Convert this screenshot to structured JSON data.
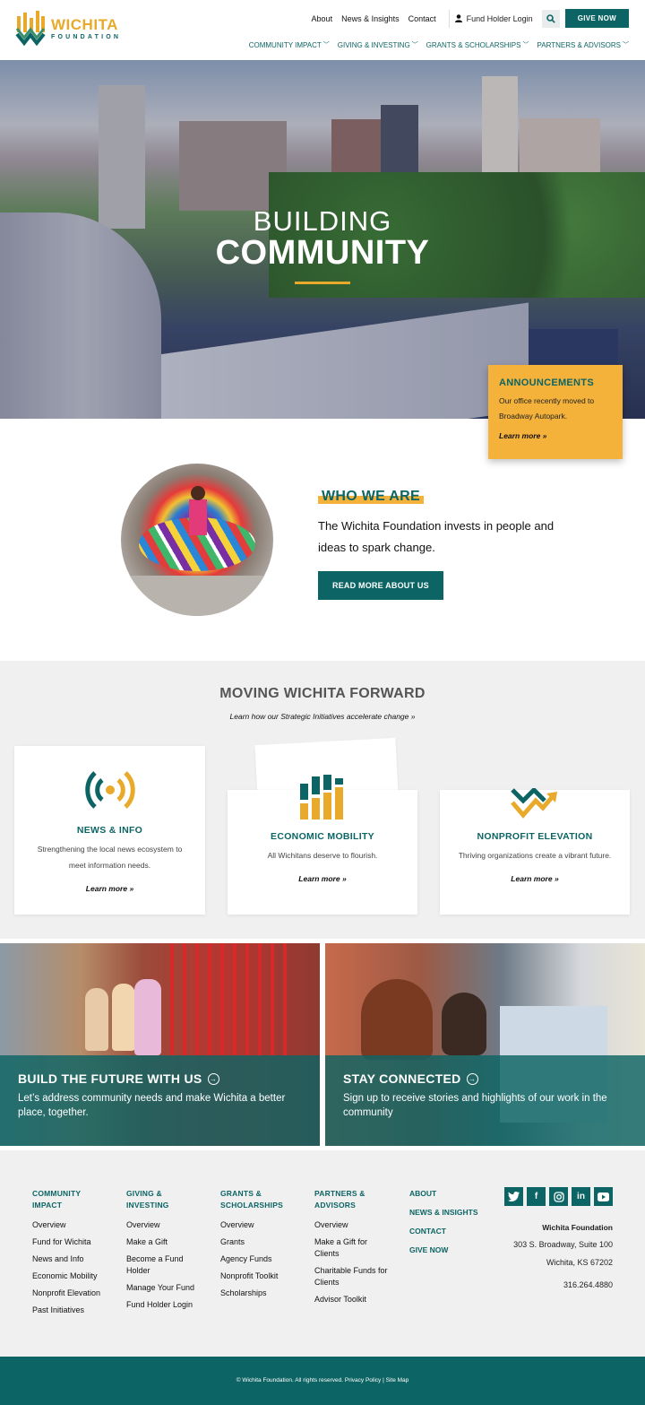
{
  "logo": {
    "line1": "WICHITA",
    "line2": "FOUNDATION"
  },
  "top_links": {
    "about": "About",
    "news": "News & Insights",
    "contact": "Contact",
    "fund_holder": "Fund Holder Login",
    "give": "GIVE NOW"
  },
  "nav": [
    "COMMUNITY IMPACT",
    "GIVING & INVESTING",
    "GRANTS & SCHOLARSHIPS",
    "PARTNERS & ADVISORS"
  ],
  "hero": {
    "line1": "BUILDING",
    "line2": "COMMUNITY"
  },
  "announcement": {
    "title": "ANNOUNCEMENTS",
    "body": "Our office recently moved to Broadway Autopark.",
    "link": "Learn more »"
  },
  "who": {
    "heading": "WHO WE ARE",
    "body": "The Wichita Foundation invests in people and ideas to spark change.",
    "button": "READ MORE ABOUT US"
  },
  "moving": {
    "title": "MOVING WICHITA FORWARD",
    "subtitle": "Learn how our Strategic Initiatives accelerate change »",
    "cards": [
      {
        "title": "NEWS & INFO",
        "body": "Strengthening the local news ecosystem to meet information needs.",
        "link": "Learn more »"
      },
      {
        "title": "ECONOMIC MOBILITY",
        "body": "All Wichitans deserve to flourish.",
        "link": "Learn more »"
      },
      {
        "title": "NONPROFIT ELEVATION",
        "body": "Thriving organizations create a vibrant future.",
        "link": "Learn more »"
      }
    ]
  },
  "promos": [
    {
      "title": "BUILD THE FUTURE WITH US",
      "body": "Let’s address community needs and make Wichita a better place, together."
    },
    {
      "title": "STAY CONNECTED",
      "body": "Sign up to receive stories and highlights of our work in the community"
    }
  ],
  "footer": {
    "col1": {
      "heading": "COMMUNITY IMPACT",
      "links": [
        "Overview",
        "Fund for Wichita",
        "News and Info",
        "Economic Mobility",
        "Nonprofit Elevation",
        "Past Initiatives"
      ]
    },
    "col2": {
      "heading": "GIVING & INVESTING",
      "links": [
        "Overview",
        "Make a Gift",
        "Become a Fund Holder",
        "Manage Your Fund",
        "Fund Holder Login"
      ]
    },
    "col3": {
      "heading": "GRANTS & SCHOLARSHIPS",
      "links": [
        "Overview",
        "Grants",
        "Agency Funds",
        "Nonprofit Toolkit",
        "Scholarships"
      ]
    },
    "col4": {
      "heading": "PARTNERS & ADVISORS",
      "links": [
        "Overview",
        "Make a Gift for Clients",
        "Charitable Funds for Clients",
        "Advisor Toolkit"
      ]
    },
    "col5": [
      "ABOUT",
      "NEWS & INSIGHTS",
      "CONTACT",
      "GIVE NOW"
    ],
    "social": [
      "twitter-icon",
      "facebook-icon",
      "instagram-icon",
      "linkedin-icon",
      "youtube-icon"
    ],
    "address": {
      "org": "Wichita Foundation",
      "street": "303 S. Broadway, Suite 100",
      "city": "Wichita, KS 67202",
      "phone": "316.264.4880"
    },
    "copyright": "© Wichita Foundation. All rights reserved. Privacy Policy | Site Map"
  },
  "colors": {
    "teal": "#0d6464",
    "gold": "#f4b23a",
    "gray_bg": "#f0f0f0"
  }
}
